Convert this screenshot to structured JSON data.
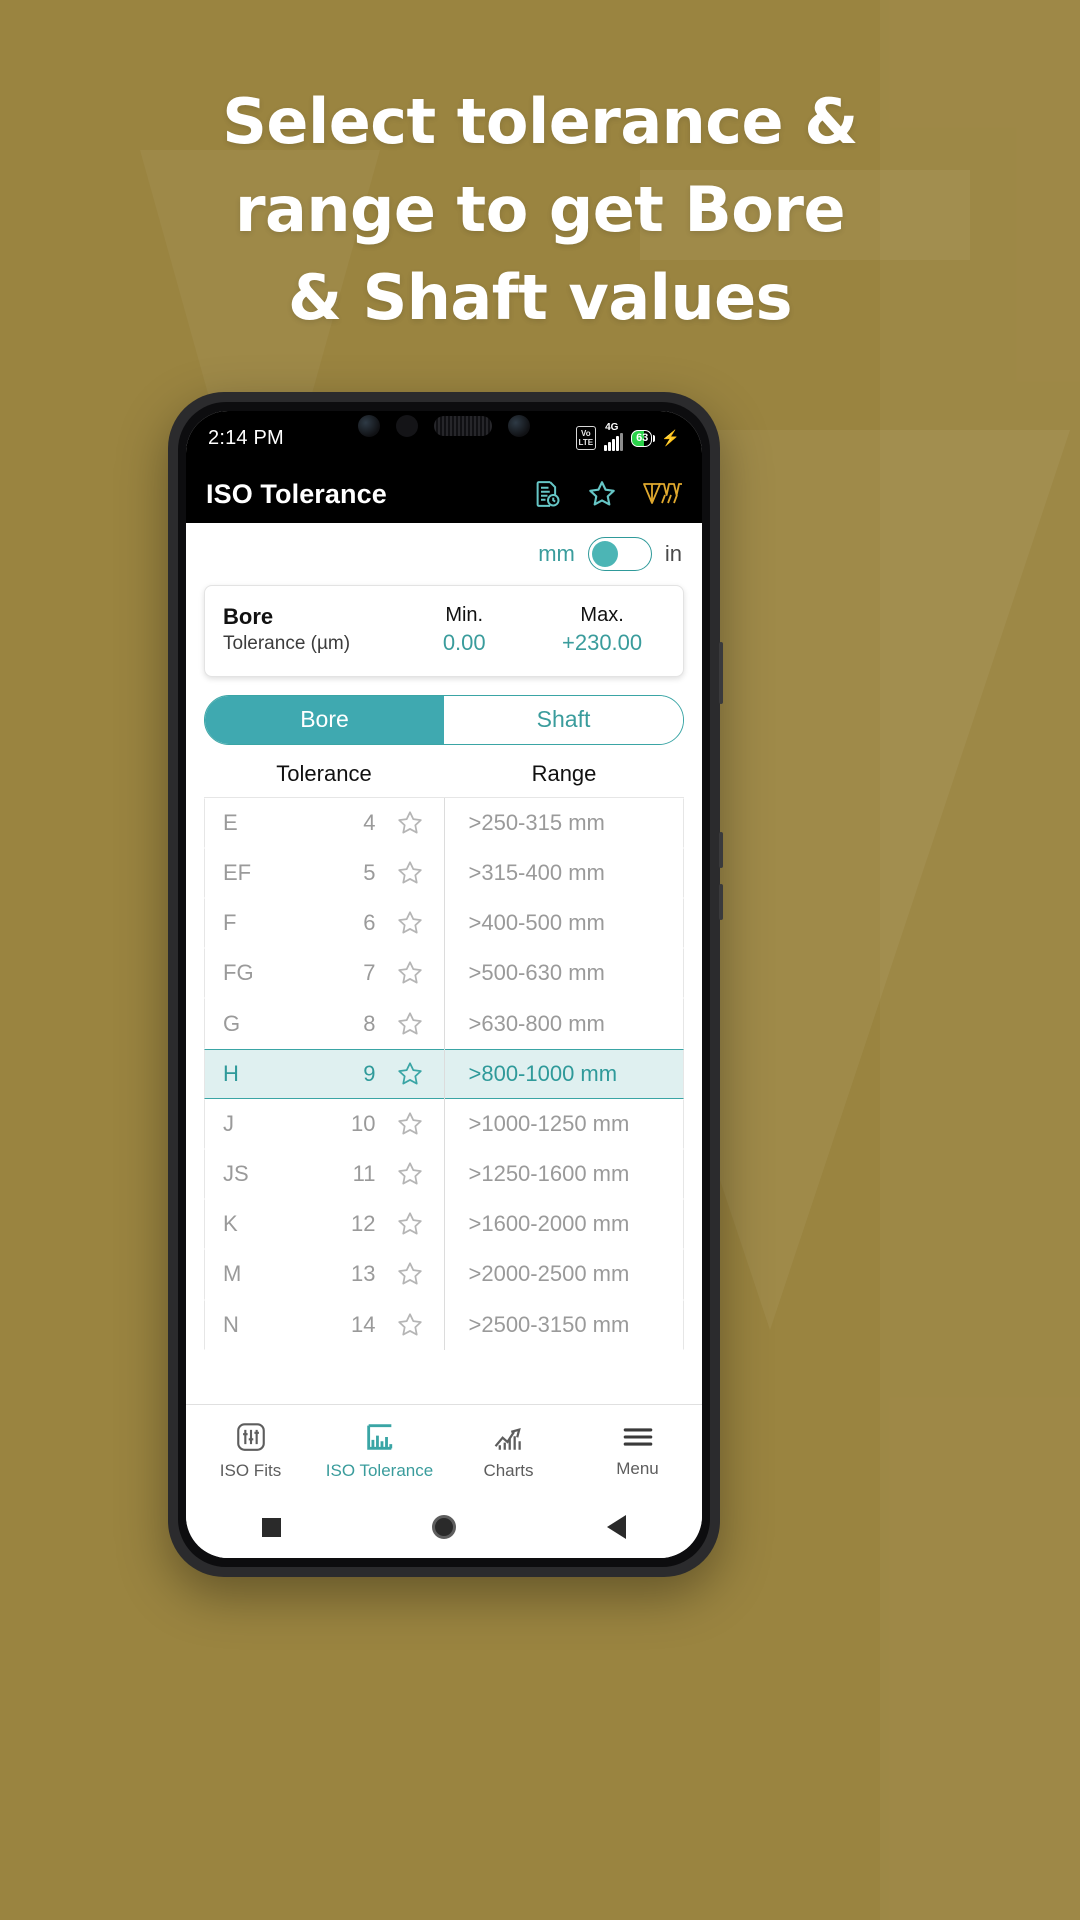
{
  "promo": {
    "headline_lines": [
      "Select tolerance &",
      "range to get Bore",
      "& Shaft values"
    ],
    "background_color": "#9a8440",
    "accent_color": "#3a9c9c"
  },
  "status_bar": {
    "time": "2:14 PM",
    "volte_line1": "Vo",
    "volte_line2": "LTE",
    "network": "4G",
    "battery_percent": "63"
  },
  "app_bar": {
    "title": "ISO Tolerance",
    "icons": [
      "history-document-icon",
      "favorite-star-icon",
      "brand-logo-icon"
    ]
  },
  "unit_toggle": {
    "left_label": "mm",
    "right_label": "in",
    "selected": "mm"
  },
  "result_card": {
    "title": "Bore",
    "subtitle": "Tolerance (µm)",
    "min_label": "Min.",
    "min_value": "0.00",
    "max_label": "Max.",
    "max_value": "+230.00"
  },
  "segmented": {
    "options": [
      "Bore",
      "Shaft"
    ],
    "selected": "Bore"
  },
  "columns": {
    "tolerance_header": "Tolerance",
    "range_header": "Range"
  },
  "tolerance_rows": [
    {
      "letter": "E",
      "grade": "4",
      "selected": false
    },
    {
      "letter": "EF",
      "grade": "5",
      "selected": false
    },
    {
      "letter": "F",
      "grade": "6",
      "selected": false
    },
    {
      "letter": "FG",
      "grade": "7",
      "selected": false
    },
    {
      "letter": "G",
      "grade": "8",
      "selected": false
    },
    {
      "letter": "H",
      "grade": "9",
      "selected": true
    },
    {
      "letter": "J",
      "grade": "10",
      "selected": false
    },
    {
      "letter": "JS",
      "grade": "11",
      "selected": false
    },
    {
      "letter": "K",
      "grade": "12",
      "selected": false
    },
    {
      "letter": "M",
      "grade": "13",
      "selected": false
    },
    {
      "letter": "N",
      "grade": "14",
      "selected": false
    }
  ],
  "range_rows": [
    {
      "label": ">250-315 mm",
      "selected": false
    },
    {
      "label": ">315-400 mm",
      "selected": false
    },
    {
      "label": ">400-500 mm",
      "selected": false
    },
    {
      "label": ">500-630 mm",
      "selected": false
    },
    {
      "label": ">630-800 mm",
      "selected": false
    },
    {
      "label": ">800-1000 mm",
      "selected": true
    },
    {
      "label": ">1000-1250 mm",
      "selected": false
    },
    {
      "label": ">1250-1600 mm",
      "selected": false
    },
    {
      "label": ">1600-2000 mm",
      "selected": false
    },
    {
      "label": ">2000-2500 mm",
      "selected": false
    },
    {
      "label": ">2500-3150 mm",
      "selected": false
    }
  ],
  "bottom_nav": {
    "items": [
      {
        "label": "ISO Fits",
        "icon": "sliders-icon",
        "active": false
      },
      {
        "label": "ISO Tolerance",
        "icon": "bar-chart-icon",
        "active": true
      },
      {
        "label": "Charts",
        "icon": "trend-up-icon",
        "active": false
      },
      {
        "label": "Menu",
        "icon": "hamburger-icon",
        "active": false
      }
    ]
  },
  "android_nav": {
    "buttons": [
      "recents-square-icon",
      "home-circle-icon",
      "back-triangle-icon"
    ]
  }
}
